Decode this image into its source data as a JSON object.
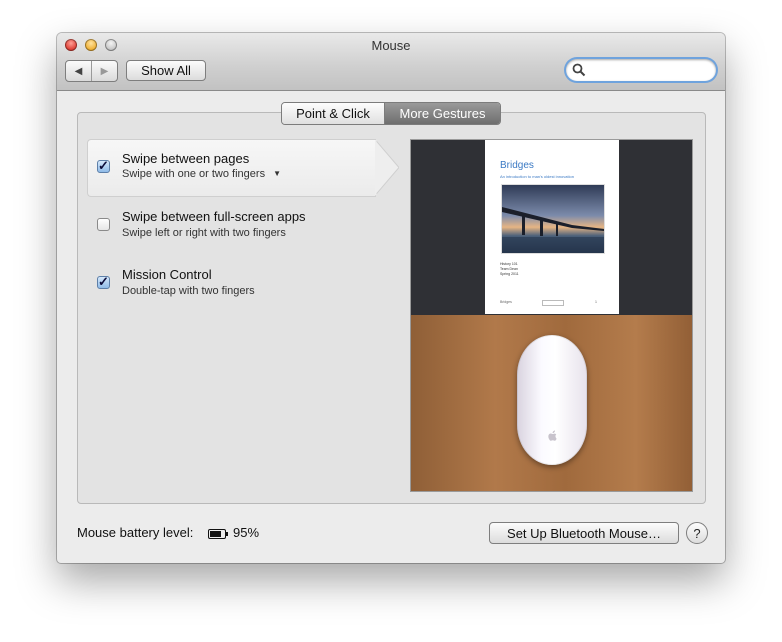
{
  "window": {
    "title": "Mouse"
  },
  "toolbar": {
    "back_icon": "◀",
    "forward_icon": "▶",
    "show_all_label": "Show All",
    "search_placeholder": ""
  },
  "tabs": [
    {
      "label": "Point & Click",
      "selected": false
    },
    {
      "label": "More Gestures",
      "selected": true
    }
  ],
  "gestures": [
    {
      "title": "Swipe between pages",
      "subtitle": "Swipe with one or two fingers",
      "checked": true,
      "has_dropdown": true,
      "selected": true
    },
    {
      "title": "Swipe between full-screen apps",
      "subtitle": "Swipe left or right with two fingers",
      "checked": false,
      "has_dropdown": false,
      "selected": false
    },
    {
      "title": "Mission Control",
      "subtitle": "Double-tap with two fingers",
      "checked": true,
      "has_dropdown": false,
      "selected": false
    }
  ],
  "preview": {
    "doc_title": "Bridges",
    "doc_subtitle": "An introduction to man's oldest innovation",
    "doc_meta": [
      "History 101",
      "Team Dean",
      "Spring 2011"
    ],
    "doc_footer_left": "Bridges",
    "doc_footer_right": "1"
  },
  "footer": {
    "battery_label": "Mouse battery level:",
    "battery_level": 0.95,
    "battery_value": "95%",
    "setup_bluetooth_label": "Set Up Bluetooth Mouse…",
    "help_label": "?"
  },
  "colors": {
    "accent": "#6fa3dd",
    "selected_tab": "#7a7a7a",
    "preview_title": "#3a79c4"
  }
}
